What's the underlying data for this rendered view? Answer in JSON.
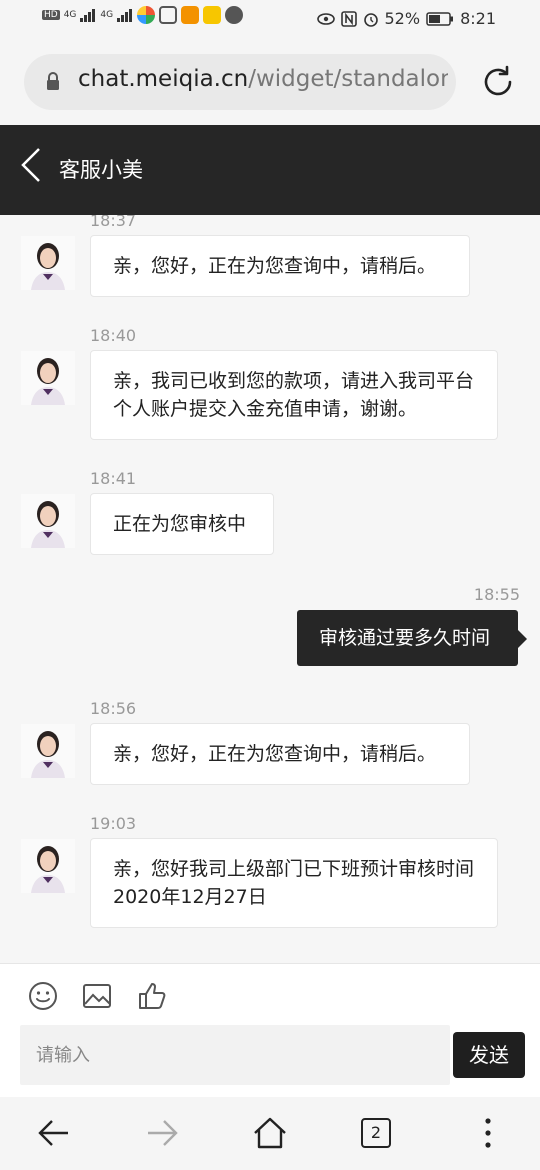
{
  "status_bar": {
    "left_labels": [
      "HD",
      "4G",
      "4G"
    ],
    "battery": "52%",
    "time": "8:21"
  },
  "browser": {
    "url_host": "chat.meiqia.cn",
    "url_path": "/widget/standalone",
    "tab_count": "2"
  },
  "header": {
    "title": "客服小美"
  },
  "messages": [
    {
      "time": "18:37",
      "from": "agent",
      "text": "亲，您好，正在为您查询中，请稍后。"
    },
    {
      "time": "18:40",
      "from": "agent",
      "text": "亲，我司已收到您的款项，请进入我司平台个人账户提交入金充值申请，谢谢。"
    },
    {
      "time": "18:41",
      "from": "agent",
      "text": "正在为您审核中"
    },
    {
      "time": "18:55",
      "from": "user",
      "text": "审核通过要多久时间"
    },
    {
      "time": "18:56",
      "from": "agent",
      "text": "亲，您好，正在为您查询中，请稍后。"
    },
    {
      "time": "19:03",
      "from": "agent",
      "text": "亲，您好我司上级部门已下班预计审核时间2020年12月27日"
    }
  ],
  "composer": {
    "placeholder": "请输入",
    "send_label": "发送"
  },
  "colors": {
    "header_bg": "#262626",
    "user_bubble": "#262626",
    "agent_bubble": "#ffffff"
  }
}
